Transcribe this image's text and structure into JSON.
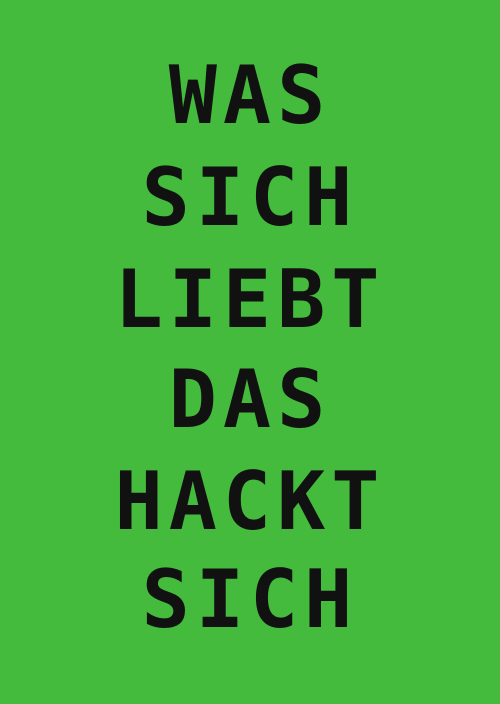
{
  "poster": {
    "background_color": "#44bb3c",
    "text_color": "#111111",
    "lines": [
      "WAS",
      "SICH",
      "LIEBT",
      "DAS",
      "HACKT",
      "SICH"
    ]
  }
}
